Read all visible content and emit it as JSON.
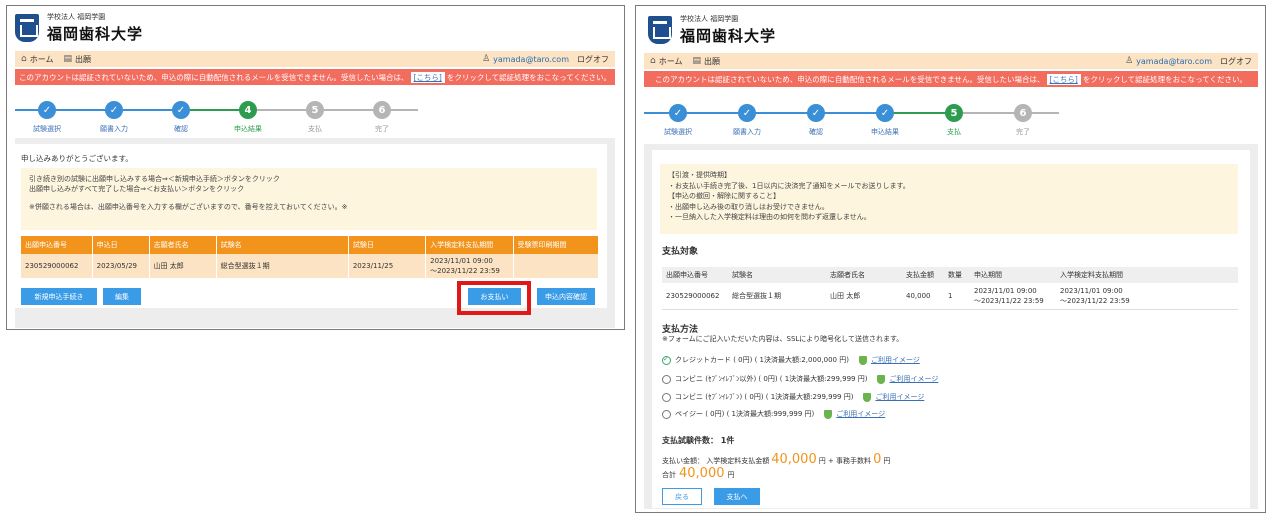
{
  "logo": {
    "sub": "学校法人 福岡学園",
    "main": "福岡歯科大学"
  },
  "nav": {
    "home": "ホーム",
    "apply": "出願",
    "email": "yamada@taro.com",
    "logout": "ログオフ"
  },
  "alert": {
    "before": "このアカウントは認証されていないため、申込の際に自動配信されるメールを受信できません。受信したい場合は、",
    "link": "[こちら]",
    "after": "をクリックして認証処理をおこなってください。"
  },
  "left_steps": [
    {
      "num": "",
      "label": "試験選択",
      "state": "done"
    },
    {
      "num": "",
      "label": "願書入力",
      "state": "done"
    },
    {
      "num": "",
      "label": "確認",
      "state": "done"
    },
    {
      "num": "4",
      "label": "申込結果",
      "state": "cur"
    },
    {
      "num": "5",
      "label": "支払",
      "state": "todo"
    },
    {
      "num": "6",
      "label": "完了",
      "state": "todo"
    }
  ],
  "right_steps": [
    {
      "num": "",
      "label": "試験選択",
      "state": "done"
    },
    {
      "num": "",
      "label": "願書入力",
      "state": "done"
    },
    {
      "num": "",
      "label": "確認",
      "state": "done"
    },
    {
      "num": "",
      "label": "申込結果",
      "state": "done"
    },
    {
      "num": "5",
      "label": "支払",
      "state": "cur"
    },
    {
      "num": "6",
      "label": "完了",
      "state": "todo"
    }
  ],
  "left": {
    "thanks": "申し込みありがとうございます。",
    "notice_line1": "引き続き別の試験に出願申し込みする場合⇒＜新規申込手続＞ボタンをクリック",
    "notice_line2": "出願申し込みがすべて完了した場合⇒＜お支払い＞ボタンをクリック",
    "notice_line3": "※併願される場合は、出願申込番号を入力する欄がございますので、番号を控えておいてください。※",
    "headers": [
      "出願申込番号",
      "申込日",
      "志願者氏名",
      "試験名",
      "試験日",
      "入学検定料支払期間",
      "受験票印刷期間"
    ],
    "row": [
      "230529000062",
      "2023/05/29",
      "山田 太郎",
      "総合型選抜１期",
      "2023/11/25",
      "2023/11/01 09:00",
      "～2023/11/22 23:59",
      ""
    ],
    "btn_new": "新規申込手続き",
    "btn_edit": "編集",
    "btn_pay": "お支払い",
    "btn_confirm": "申込内容確認"
  },
  "right": {
    "notice": [
      "【引渡・提供時期】",
      "・お支払い手続き完了後、1日以内に決済完了通知をメールでお送りします。",
      "【申込の撤回・解除に関すること】",
      "・出願申し込み後の取り消しはお受けできません。",
      "・一旦納入した入学検定料は理由の如何を問わず返還しません。"
    ],
    "target_title": "支払対象",
    "headers": [
      "出願申込番号",
      "試験名",
      "志願者氏名",
      "支払金額",
      "数量",
      "申込期間",
      "入学検定料支払期間"
    ],
    "row": {
      "no": "230529000062",
      "exam": "総合型選抜１期",
      "name": "山田 太郎",
      "amount": "40,000",
      "qty": "1",
      "apply1": "2023/11/01 09:00",
      "apply2": "～2023/11/22 23:59",
      "pay1": "2023/11/01 09:00",
      "pay2": "～2023/11/22 23:59"
    },
    "method_title": "支払方法",
    "method_note": "※フォームにご記入いただいた内容は、SSLにより暗号化して送信されます。",
    "methods": [
      {
        "label": "クレジットカード ( 0円) ( 1決済最大額:2,000,000 円)",
        "link": "ご利用イメージ",
        "checked": true
      },
      {
        "label": "コンビニ (ｾﾌﾞﾝｲﾚﾌﾞﾝ以外) ( 0円) ( 1決済最大額:299,999 円)",
        "link": "ご利用イメージ",
        "checked": false
      },
      {
        "label": "コンビニ (ｾﾌﾞﾝｲﾚﾌﾞﾝ) ( 0円) ( 1決済最大額:299,999 円)",
        "link": "ご利用イメージ",
        "checked": false
      },
      {
        "label": "ペイジー ( 0円) ( 1決済最大額:999,999 円)",
        "link": "ご利用イメージ",
        "checked": false
      }
    ],
    "count_label": "支払試験件数： 1件",
    "pay_prefix": "支払い金額： 入学検定料支払金額",
    "pay_amount": "40,000",
    "pay_mid": "円 + 事務手数料",
    "fee": "0",
    "yen": "円",
    "total_label": "合計",
    "total": "40,000",
    "btn_back": "戻る",
    "btn_pay": "支払へ"
  }
}
